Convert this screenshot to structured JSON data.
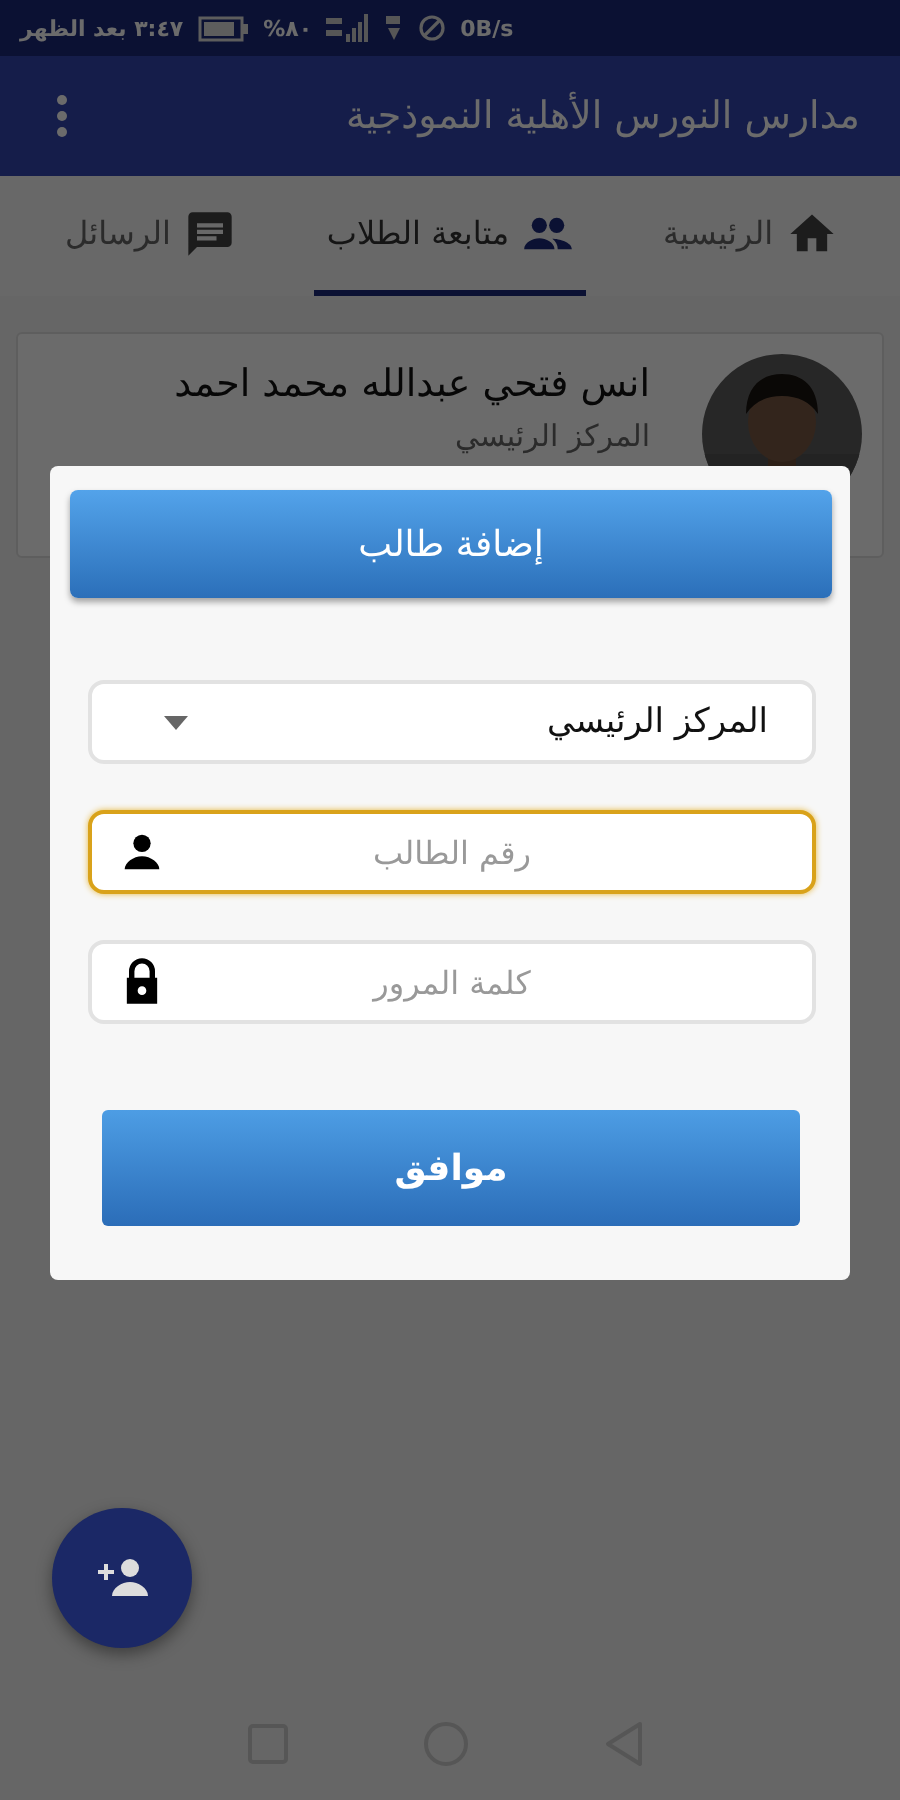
{
  "status_bar": {
    "time": "٣:٤٧ بعد الظهر",
    "battery": "%٨٠",
    "speed": "0B/s"
  },
  "app_bar": {
    "title": "مدارس النورس الأهلية النموذجية"
  },
  "tabs": [
    {
      "label": "الرئيسية",
      "selected": false
    },
    {
      "label": "متابعة الطلاب",
      "selected": true
    },
    {
      "label": "الرسائل",
      "selected": false
    }
  ],
  "students": [
    {
      "name": "انس فتحي عبدالله محمد احمد",
      "branch": "المركز الرئيسي"
    }
  ],
  "dialog": {
    "title": "إضافة طالب",
    "fields": [
      {
        "kind": "select",
        "value": "المركز الرئيسي"
      },
      {
        "kind": "text",
        "placeholder": "رقم الطالب",
        "focused": true
      },
      {
        "kind": "password",
        "placeholder": "كلمة المرور",
        "focused": false
      }
    ],
    "confirm": "موافق"
  }
}
